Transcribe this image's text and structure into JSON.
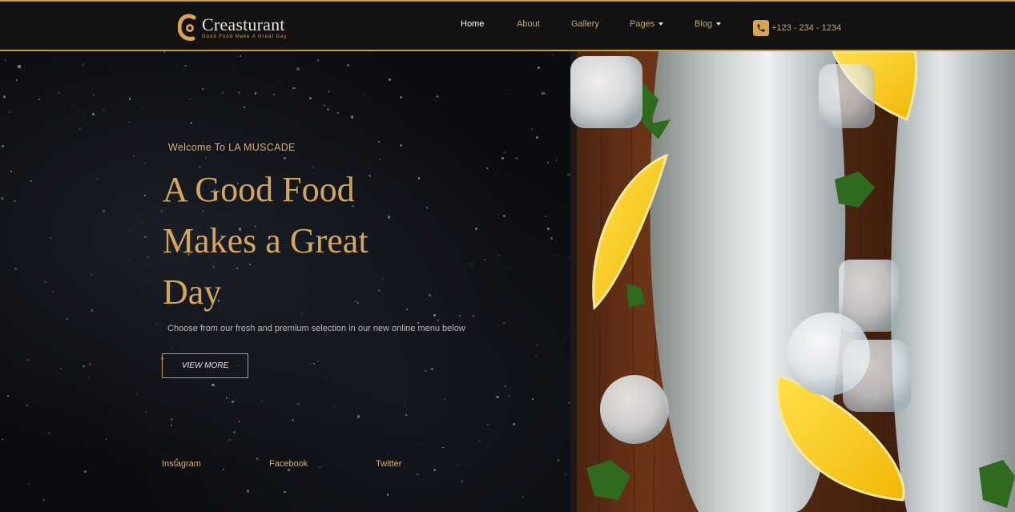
{
  "brand": {
    "name": "Creasturant",
    "tagline": "Good Food Make A Great Day",
    "accent_color": "#d4a85b"
  },
  "nav": {
    "items": [
      {
        "label": "Home",
        "active": true
      },
      {
        "label": "About"
      },
      {
        "label": "Gallery"
      },
      {
        "label": "Pages",
        "dropdown": true
      },
      {
        "label": "Blog",
        "dropdown": true
      }
    ],
    "phone": {
      "icon": "phone-icon",
      "label": "+123 - 234 - 1234"
    }
  },
  "hero": {
    "welcome": "Welcome To LA MUSCADE",
    "headline_lines": [
      "A Good Food",
      "Makes a Great",
      "Day"
    ],
    "subtext": "Choose from our fresh and premium selection in our new online menu below",
    "cta_label": "VIEW MORE",
    "image": "fresh-fish-on-wooden-board-with-lemon-ice-and-parsley"
  },
  "social": [
    "Instagram",
    "Facebook",
    "Twitter"
  ]
}
